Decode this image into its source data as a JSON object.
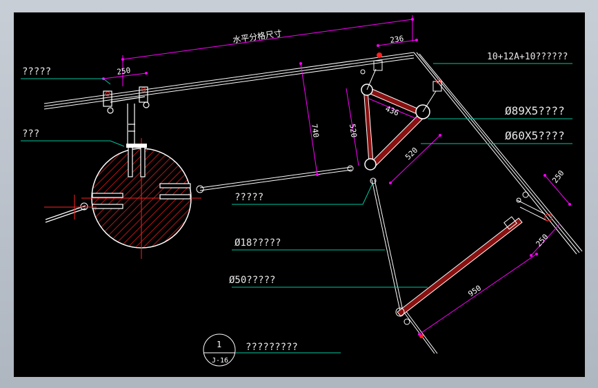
{
  "colors": {
    "background": "#000000",
    "frame": "#b9c1cb",
    "structure": "#ffffff",
    "dimension": "#ff00ff",
    "leader": "#00c8a0",
    "hatch": "#ff2020",
    "member_fill": "#8a1010",
    "text": "#e8e8e8",
    "callout_text": "#00ffff"
  },
  "dimensions": {
    "top_span": "水平分格尺寸",
    "d236": "236",
    "d250_left": "250",
    "d740": "740",
    "d520_vertical": "520",
    "d436": "436",
    "d520_diag": "520",
    "d250_right_top": "250",
    "d250_right_mid": "250",
    "d950": "950"
  },
  "callouts": {
    "glass_spec": "10+12A+10??????",
    "left_top_label": "?????",
    "left_mid_label": "???",
    "tube89": "Ø89X5????",
    "tube60": "Ø60X5????",
    "center_label": "?????",
    "rod18": "Ø18?????",
    "rod50": "Ø50?????"
  },
  "title_block": {
    "number": "1",
    "sheet": "J-16",
    "title": "?????????"
  }
}
